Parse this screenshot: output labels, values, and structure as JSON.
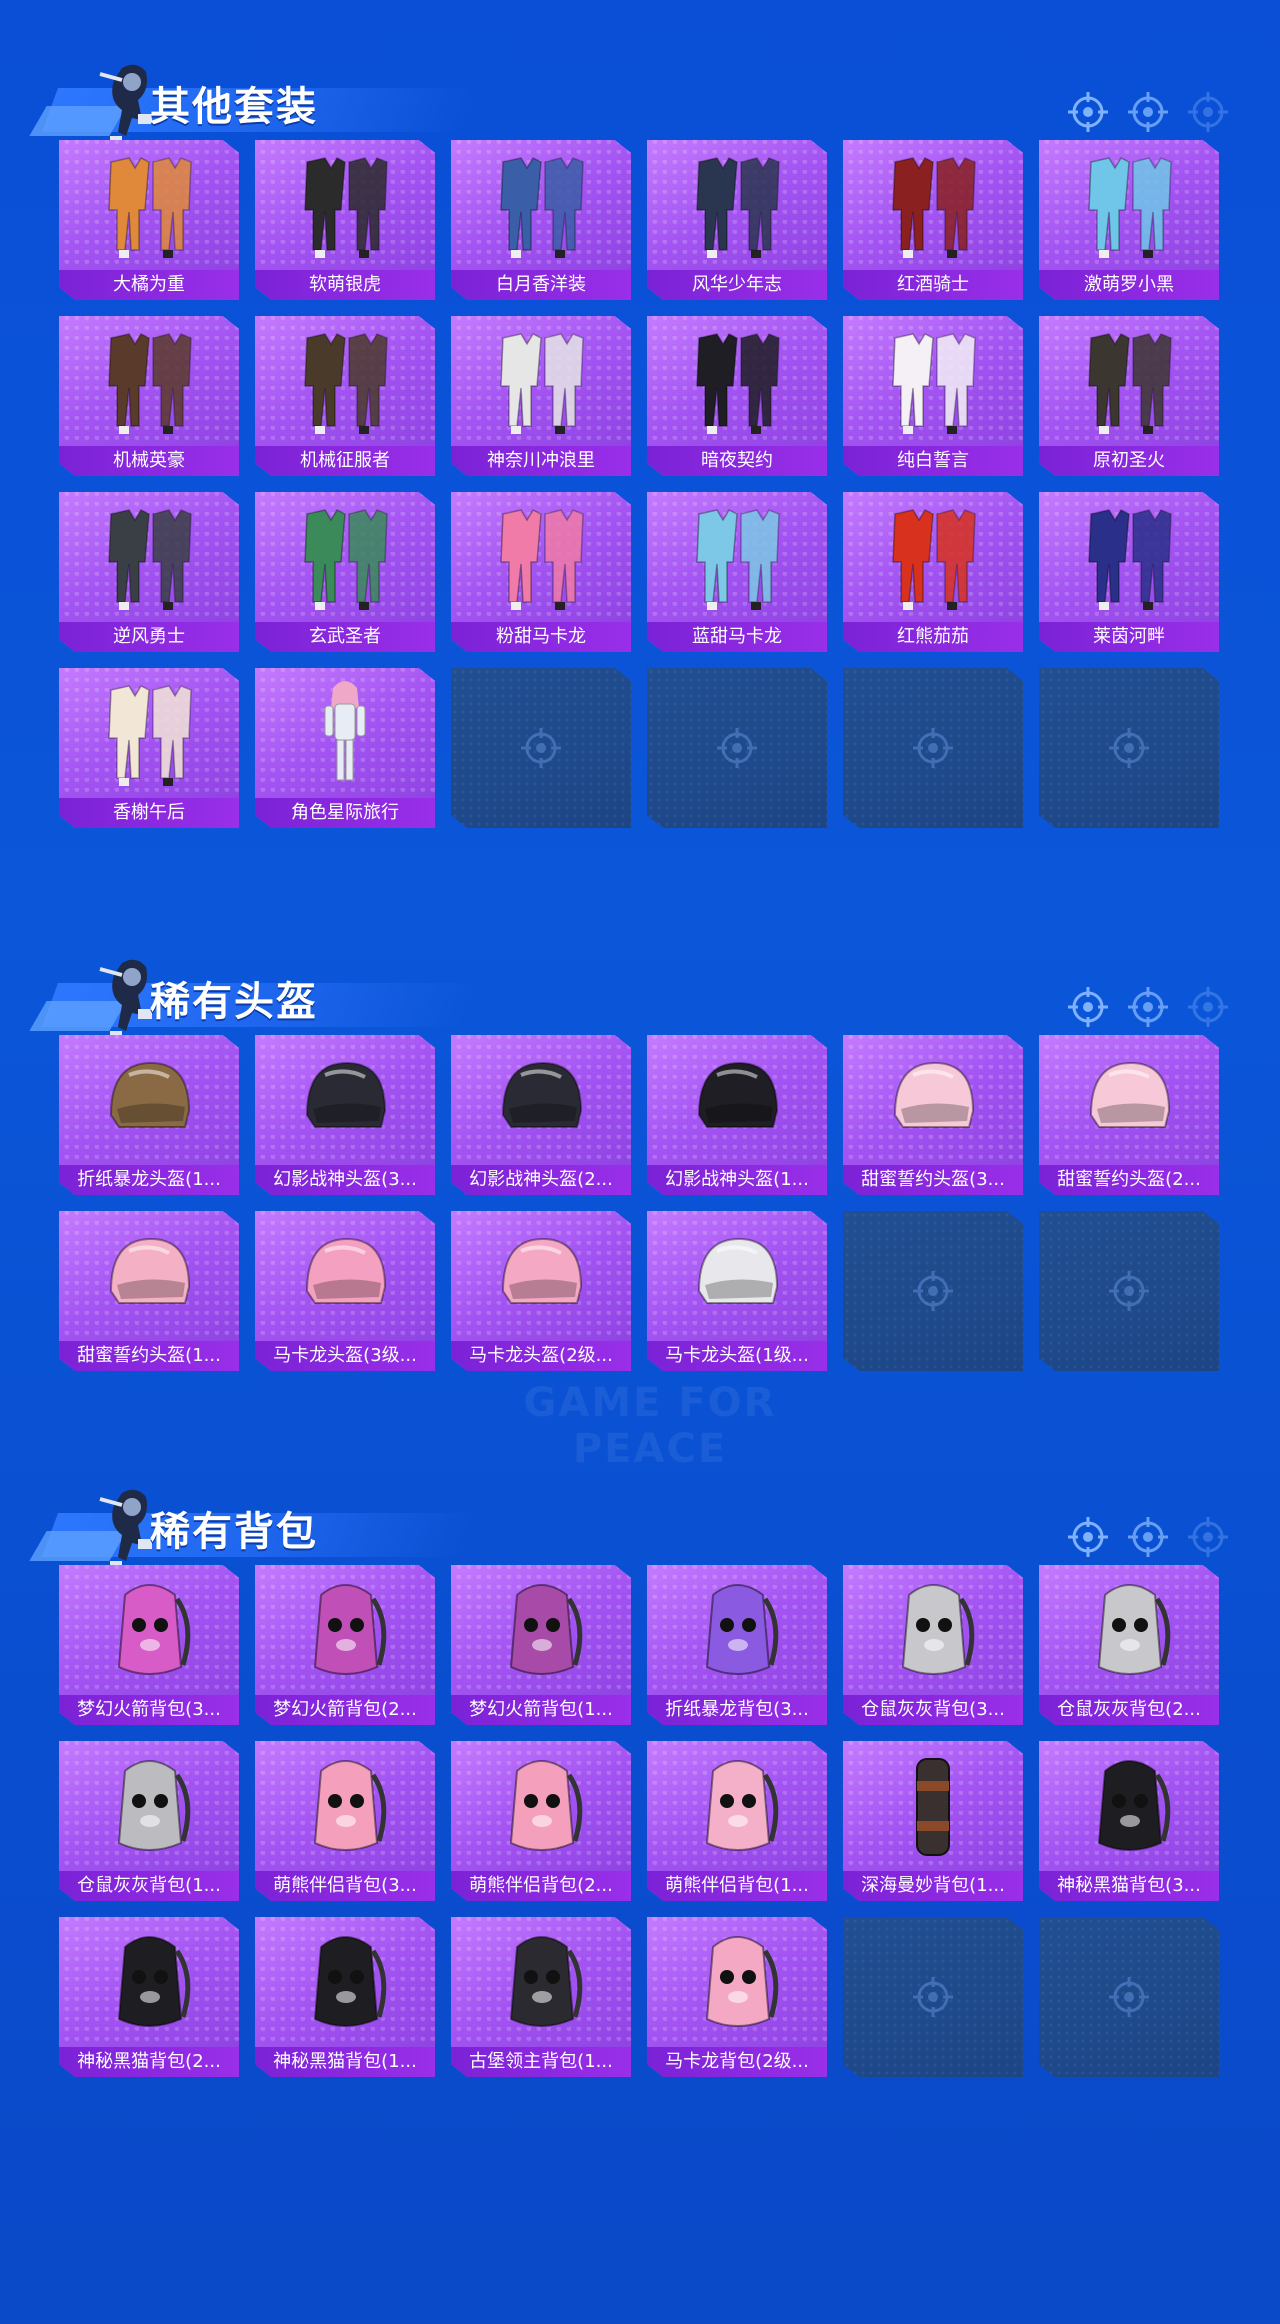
{
  "sections": [
    {
      "title": "其他套装",
      "items": [
        {
          "label": "大橘为重",
          "type": "outfit",
          "color": "#e0893a"
        },
        {
          "label": "软萌银虎",
          "type": "outfit",
          "color": "#2b2b2b"
        },
        {
          "label": "白月香洋装",
          "type": "outfit",
          "color": "#3a5ea8"
        },
        {
          "label": "风华少年志",
          "type": "outfit",
          "color": "#2a3550"
        },
        {
          "label": "红酒骑士",
          "type": "outfit",
          "color": "#8a2020"
        },
        {
          "label": "激萌罗小黑",
          "type": "outfit",
          "color": "#6fc6e8"
        },
        {
          "label": "机械英豪",
          "type": "outfit",
          "color": "#5a3a2a"
        },
        {
          "label": "机械征服者",
          "type": "outfit",
          "color": "#4a3a2a"
        },
        {
          "label": "神奈川冲浪里",
          "type": "outfit",
          "color": "#e6e6e6"
        },
        {
          "label": "暗夜契约",
          "type": "outfit",
          "color": "#1e1e24"
        },
        {
          "label": "纯白誓言",
          "type": "outfit",
          "color": "#f4f0f6"
        },
        {
          "label": "原初圣火",
          "type": "outfit",
          "color": "#3c3630"
        },
        {
          "label": "逆风勇士",
          "type": "outfit",
          "color": "#3a3f46"
        },
        {
          "label": "玄武圣者",
          "type": "outfit",
          "color": "#3a8a5a"
        },
        {
          "label": "粉甜马卡龙",
          "type": "outfit",
          "color": "#f07aa8"
        },
        {
          "label": "蓝甜马卡龙",
          "type": "outfit",
          "color": "#7cc8e6"
        },
        {
          "label": "红熊茄茄",
          "type": "outfit",
          "color": "#d8321e"
        },
        {
          "label": "莱茵河畔",
          "type": "outfit",
          "color": "#2a2f8a"
        },
        {
          "label": "香榭午后",
          "type": "outfit",
          "color": "#f2e6d6"
        },
        {
          "label": "角色星际旅行",
          "type": "figure",
          "color": "#e8ecf4"
        }
      ],
      "empty_slots": 4
    },
    {
      "title": "稀有头盔",
      "items": [
        {
          "label": "折纸暴龙头盔(1...",
          "type": "helmet",
          "color": "#8a6a44"
        },
        {
          "label": "幻影战神头盔(3...",
          "type": "helmet",
          "color": "#2a2a34"
        },
        {
          "label": "幻影战神头盔(2...",
          "type": "helmet",
          "color": "#2a2a34"
        },
        {
          "label": "幻影战神头盔(1...",
          "type": "helmet",
          "color": "#1e1e24"
        },
        {
          "label": "甜蜜誓约头盔(3...",
          "type": "helmet",
          "color": "#f6c8d8"
        },
        {
          "label": "甜蜜誓约头盔(2...",
          "type": "helmet",
          "color": "#f6c8d8"
        },
        {
          "label": "甜蜜誓约头盔(1...",
          "type": "helmet",
          "color": "#f4b0c4"
        },
        {
          "label": "马卡龙头盔(3级...",
          "type": "helmet",
          "color": "#f4a0c0"
        },
        {
          "label": "马卡龙头盔(2级...",
          "type": "helmet",
          "color": "#f4a8c4"
        },
        {
          "label": "马卡龙头盔(1级...",
          "type": "helmet",
          "color": "#e8e8ec"
        }
      ],
      "empty_slots": 2
    },
    {
      "title": "稀有背包",
      "items": [
        {
          "label": "梦幻火箭背包(3...",
          "type": "backpack",
          "color": "#d85cc8"
        },
        {
          "label": "梦幻火箭背包(2...",
          "type": "backpack",
          "color": "#c050b8"
        },
        {
          "label": "梦幻火箭背包(1...",
          "type": "backpack",
          "color": "#a84aa8"
        },
        {
          "label": "折纸暴龙背包(3...",
          "type": "backpack",
          "color": "#8a5ae0"
        },
        {
          "label": "仓鼠灰灰背包(3...",
          "type": "backpack",
          "color": "#c8c8cc"
        },
        {
          "label": "仓鼠灰灰背包(2...",
          "type": "backpack",
          "color": "#c8c8cc"
        },
        {
          "label": "仓鼠灰灰背包(1...",
          "type": "backpack",
          "color": "#bcbcc0"
        },
        {
          "label": "萌熊伴侣背包(3...",
          "type": "backpack",
          "color": "#f4a0bc"
        },
        {
          "label": "萌熊伴侣背包(2...",
          "type": "backpack",
          "color": "#f4a0bc"
        },
        {
          "label": "萌熊伴侣背包(1...",
          "type": "backpack",
          "color": "#f4b0c8"
        },
        {
          "label": "深海曼妙背包(1...",
          "type": "bottle",
          "color": "#3a3030"
        },
        {
          "label": "神秘黑猫背包(3...",
          "type": "backpack",
          "color": "#1e1e22"
        },
        {
          "label": "神秘黑猫背包(2...",
          "type": "backpack",
          "color": "#1e1e22"
        },
        {
          "label": "神秘黑猫背包(1...",
          "type": "backpack",
          "color": "#1e1e22"
        },
        {
          "label": "古堡领主背包(1...",
          "type": "backpack",
          "color": "#2a2a30"
        },
        {
          "label": "马卡龙背包(2级...",
          "type": "backpack",
          "color": "#f4a8c4"
        }
      ],
      "empty_slots": 2
    }
  ],
  "watermark": "GAME FOR PEACE"
}
